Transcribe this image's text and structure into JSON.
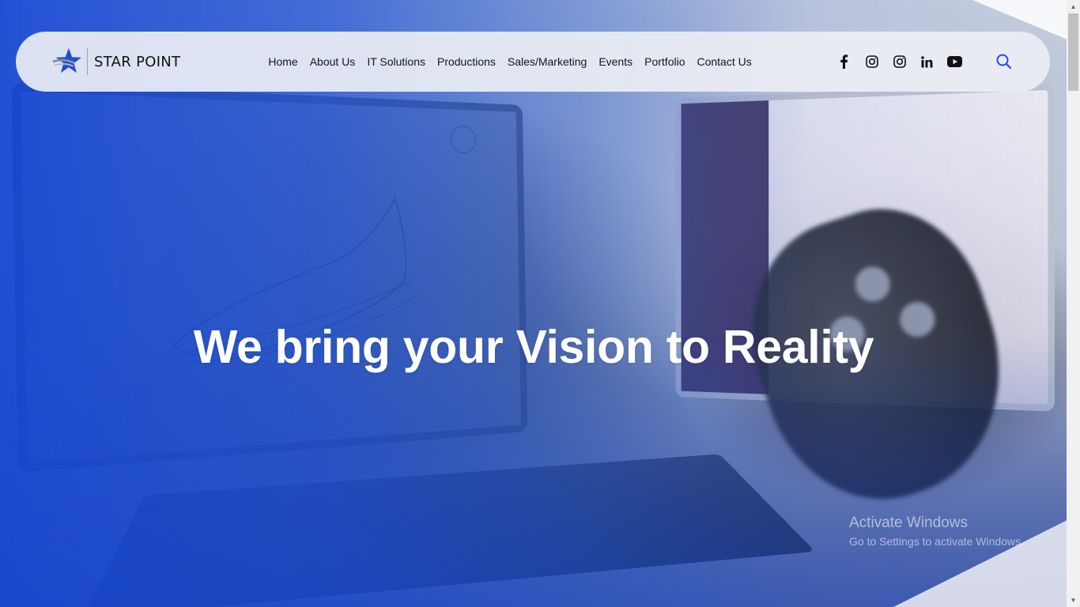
{
  "brand": {
    "name": "STAR POINT"
  },
  "nav": {
    "items": [
      {
        "label": "Home"
      },
      {
        "label": "About Us"
      },
      {
        "label": "IT Solutions"
      },
      {
        "label": "Productions"
      },
      {
        "label": "Sales/Marketing"
      },
      {
        "label": "Events"
      },
      {
        "label": "Portfolio"
      },
      {
        "label": "Contact Us"
      }
    ]
  },
  "social": [
    {
      "icon": "facebook-icon"
    },
    {
      "icon": "instagram-icon"
    },
    {
      "icon": "instagram-icon"
    },
    {
      "icon": "linkedin-icon"
    },
    {
      "icon": "youtube-icon"
    }
  ],
  "search": {
    "icon": "search-icon"
  },
  "hero": {
    "headline": "We bring your Vision to Reality"
  },
  "watermark": {
    "title": "Activate Windows",
    "subtitle": "Go to Settings to activate Windows."
  },
  "colors": {
    "accent_blue": "#1f4fd6",
    "header_bg": "#eceef4",
    "text_dark": "#161616"
  }
}
